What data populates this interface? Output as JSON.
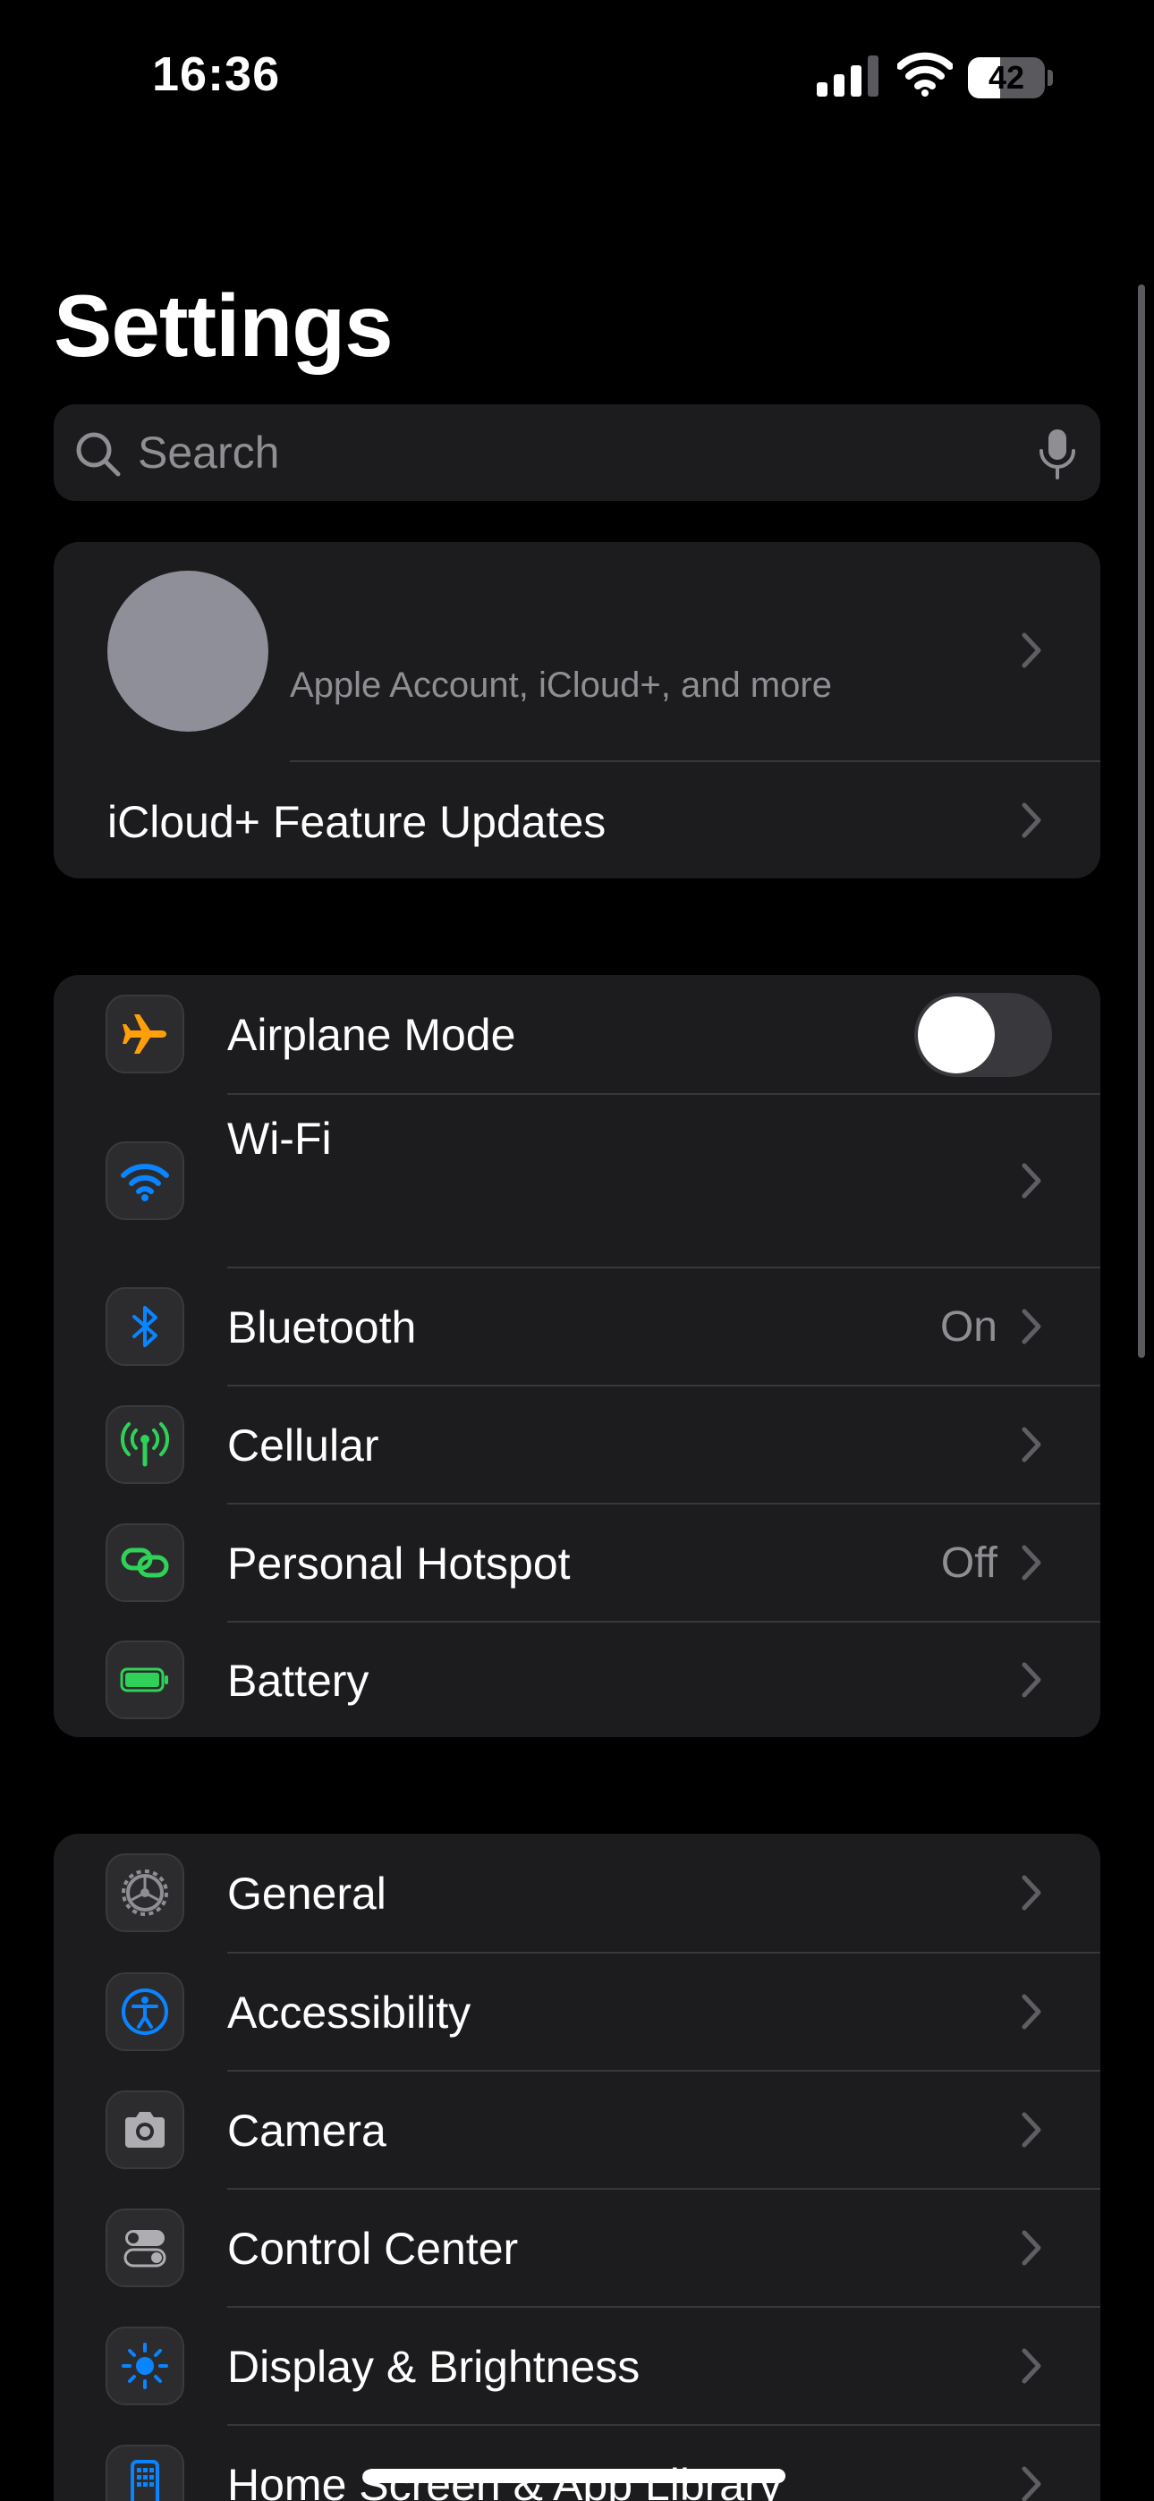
{
  "status_bar": {
    "time": "16:36",
    "battery_level": "42",
    "battery_fraction": 0.42
  },
  "page": {
    "title": "Settings"
  },
  "search": {
    "placeholder": "Search",
    "icon": "magnifying-glass",
    "mic_icon": "microphone"
  },
  "account": {
    "subtitle": "Apple Account, iCloud+, and more",
    "feature_updates_label": "iCloud+ Feature Updates"
  },
  "connectivity": {
    "airplane_mode": {
      "label": "Airplane Mode",
      "enabled": false,
      "icon": "airplane",
      "color": "#ff9f0a"
    },
    "wifi": {
      "label": "Wi-Fi",
      "icon": "wifi",
      "color": "#0a84ff"
    },
    "bluetooth": {
      "label": "Bluetooth",
      "value": "On",
      "icon": "bluetooth",
      "color": "#0a84ff"
    },
    "cellular": {
      "label": "Cellular",
      "icon": "antenna",
      "color": "#30d158"
    },
    "hotspot": {
      "label": "Personal Hotspot",
      "value": "Off",
      "icon": "chain-link",
      "color": "#30d158"
    },
    "battery": {
      "label": "Battery",
      "icon": "battery",
      "color": "#30d158"
    }
  },
  "system": {
    "general": {
      "label": "General",
      "icon": "gear",
      "color": "#8e8e93"
    },
    "accessibility": {
      "label": "Accessibility",
      "icon": "accessibility-person",
      "color": "#0a84ff"
    },
    "camera": {
      "label": "Camera",
      "icon": "camera",
      "color": "#aeaeb2"
    },
    "control_center": {
      "label": "Control Center",
      "icon": "switches",
      "color": "#aeaeb2"
    },
    "display": {
      "label": "Display & Brightness",
      "icon": "sun",
      "color": "#0a84ff"
    },
    "home_screen": {
      "label": "Home Screen & App Library",
      "icon": "phone-grid",
      "color": "#0a84ff"
    }
  },
  "colors": {
    "background": "#000000",
    "group_background": "#1c1c1e",
    "secondary_text": "#8e8e93",
    "separator": "#38383a"
  }
}
